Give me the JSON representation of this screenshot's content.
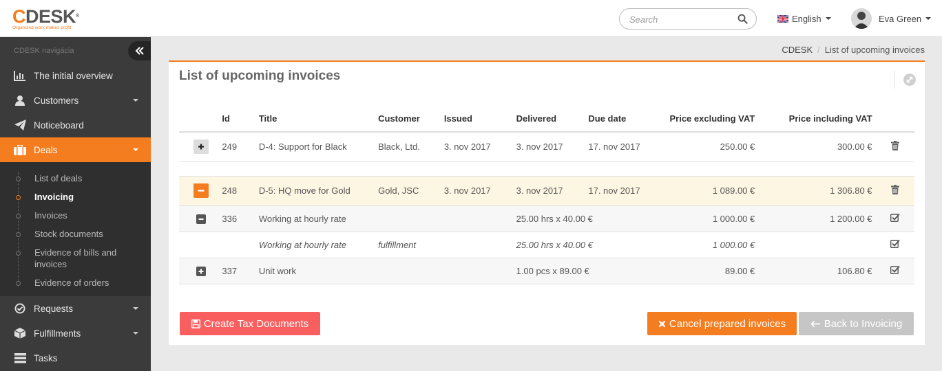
{
  "header": {
    "logo_text": "CDESK",
    "logo_tagline": "Organized work makes profit",
    "search_placeholder": "Search",
    "language": "English",
    "user_name": "Eva Green"
  },
  "sidebar": {
    "heading": "CDESK navigácia",
    "items_top": [
      {
        "label": "The initial overview"
      },
      {
        "label": "Customers"
      },
      {
        "label": "Noticeboard"
      },
      {
        "label": "Deals"
      }
    ],
    "sub_items": [
      {
        "label": "List of deals"
      },
      {
        "label": "Invoicing"
      },
      {
        "label": "Invoices"
      },
      {
        "label": "Stock documents"
      },
      {
        "label": "Evidence of bills and invoices"
      },
      {
        "label": "Evidence of orders"
      }
    ],
    "items_bottom": [
      {
        "label": "Requests"
      },
      {
        "label": "Fulfillments"
      },
      {
        "label": "Tasks"
      }
    ]
  },
  "breadcrumb": {
    "root": "CDESK",
    "current": "List of upcoming invoices"
  },
  "panel": {
    "title": "List of upcoming invoices"
  },
  "table": {
    "headers": {
      "id": "Id",
      "title": "Title",
      "customer": "Customer",
      "issued": "Issued",
      "delivered": "Delivered",
      "due": "Due date",
      "price_ex": "Price excluding VAT",
      "price_in": "Price including VAT"
    },
    "rows": [
      {
        "id": "249",
        "title": "D-4: Support for Black",
        "customer": "Black, Ltd.",
        "issued": "3. nov 2017",
        "delivered": "3. nov 2017",
        "due": "17. nov 2017",
        "price_ex": "250.00 €",
        "price_in": "300.00 €"
      },
      {
        "id": "248",
        "title": "D-5: HQ move for Gold",
        "customer": "Gold, JSC",
        "issued": "3. nov 2017",
        "delivered": "3. nov 2017",
        "due": "17. nov 2017",
        "price_ex": "1 089.00 €",
        "price_in": "1 306.80 €"
      },
      {
        "id": "336",
        "title": "Working at hourly rate",
        "customer": "",
        "issued": "",
        "delivered": "25.00 hrs x 40.00 €",
        "due": "",
        "price_ex": "1 000.00 €",
        "price_in": "1 200.00 €"
      },
      {
        "id": "",
        "title": "Working at hourly rate",
        "customer": "fulfillment",
        "issued": "",
        "delivered": "25.00 hrs x 40.00 €",
        "due": "",
        "price_ex": "1 000.00 €",
        "price_in": ""
      },
      {
        "id": "337",
        "title": "Unit work",
        "customer": "",
        "issued": "",
        "delivered": "1.00 pcs x 89.00 €",
        "due": "",
        "price_ex": "89.00 €",
        "price_in": "106.80 €"
      }
    ]
  },
  "buttons": {
    "create": "Create Tax Documents",
    "cancel": "Cancel prepared invoices",
    "back": "Back to Invoicing"
  },
  "colors": {
    "accent": "#f47d20",
    "danger": "#f95f5f",
    "sidebar": "#3b3b3b"
  }
}
